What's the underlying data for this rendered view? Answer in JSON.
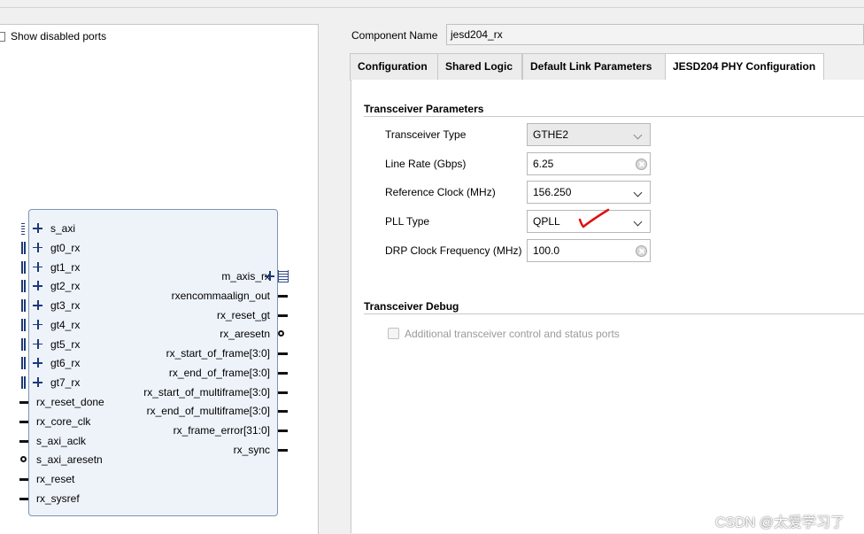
{
  "left_panel": {
    "show_disabled_ports_label": "Show disabled ports",
    "block": {
      "left_bus_ports": [
        "s_axi",
        "gt0_rx",
        "gt1_rx",
        "gt2_rx",
        "gt3_rx",
        "gt4_rx",
        "gt5_rx",
        "gt6_rx",
        "gt7_rx"
      ],
      "left_ports": [
        "rx_reset_done",
        "rx_core_clk",
        "s_axi_aclk",
        "s_axi_aresetn",
        "rx_reset",
        "rx_sysref"
      ],
      "right_ports": [
        "m_axis_rx",
        "rxencommaalign_out",
        "rx_reset_gt",
        "rx_aresetn",
        "rx_start_of_frame[3:0]",
        "rx_end_of_frame[3:0]",
        "rx_start_of_multiframe[3:0]",
        "rx_end_of_multiframe[3:0]",
        "rx_frame_error[31:0]",
        "rx_sync"
      ]
    }
  },
  "right_panel": {
    "component_name_label": "Component Name",
    "component_name_value": "jesd204_rx",
    "tabs": [
      "Configuration",
      "Shared Logic",
      "Default Link Parameters",
      "JESD204 PHY Configuration"
    ],
    "active_tab": "JESD204 PHY Configuration",
    "transceiver_section_title": "Transceiver Parameters",
    "params": {
      "transceiver_type": {
        "label": "Transceiver Type",
        "value": "GTHE2"
      },
      "line_rate": {
        "label": "Line Rate (Gbps)",
        "value": "6.25"
      },
      "ref_clock": {
        "label": "Reference Clock (MHz)",
        "value": "156.250"
      },
      "pll_type": {
        "label": "PLL Type",
        "value": "QPLL"
      },
      "drp_clock": {
        "label": "DRP Clock Frequency (MHz)",
        "value": "100.0"
      }
    },
    "debug_section_title": "Transceiver Debug",
    "debug_checkbox_label": "Additional transceiver control and status ports"
  },
  "watermark": "CSDN @太爱学习了",
  "colors": {
    "block_fill": "#eef3fa",
    "block_border": "#7d93b2",
    "annotation_red": "#e01010"
  }
}
